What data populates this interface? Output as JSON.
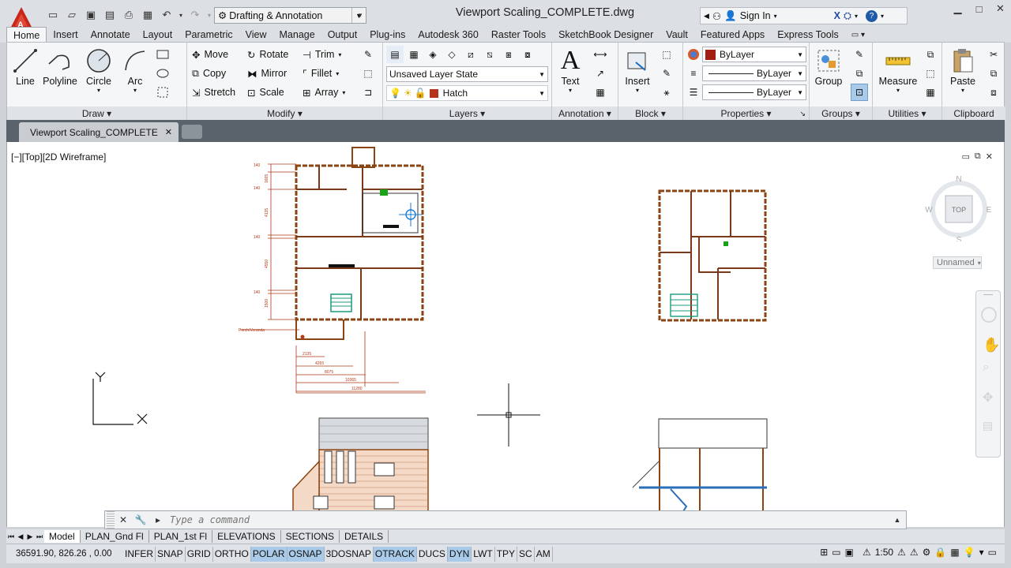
{
  "app": {
    "doc_title": "Viewport Scaling_COMPLETE.dwg",
    "workspace": "Drafting & Annotation",
    "sign_in": "Sign In",
    "accent": "#c8261a"
  },
  "ribbon_tabs": [
    "Home",
    "Insert",
    "Annotate",
    "Layout",
    "Parametric",
    "View",
    "Manage",
    "Output",
    "Plug-ins",
    "Autodesk 360",
    "Raster Tools",
    "SketchBook Designer",
    "Vault",
    "Featured Apps",
    "Express Tools"
  ],
  "draw": {
    "title": "Draw",
    "line": "Line",
    "polyline": "Polyline",
    "circle": "Circle",
    "arc": "Arc"
  },
  "modify": {
    "title": "Modify",
    "move": "Move",
    "rotate": "Rotate",
    "trim": "Trim",
    "copy": "Copy",
    "mirror": "Mirror",
    "fillet": "Fillet",
    "stretch": "Stretch",
    "scale": "Scale",
    "array": "Array"
  },
  "layers": {
    "title": "Layers",
    "state": "Unsaved Layer State",
    "current": "Hatch"
  },
  "annotation": {
    "title": "Annotation",
    "text": "Text"
  },
  "block": {
    "title": "Block",
    "insert": "Insert"
  },
  "properties": {
    "title": "Properties",
    "color": "ByLayer",
    "linetype": "ByLayer",
    "lineweight": "ByLayer"
  },
  "groups": {
    "title": "Groups",
    "group": "Group"
  },
  "utilities": {
    "title": "Utilities",
    "measure": "Measure"
  },
  "clipboard": {
    "title": "Clipboard",
    "paste": "Paste"
  },
  "file_tab": "Viewport Scaling_COMPLETE",
  "viewport": {
    "label": "[−][Top][2D Wireframe]",
    "cube_top": "TOP",
    "n": "N",
    "s": "S",
    "e": "E",
    "w": "W",
    "ucs_name": "Unnamed"
  },
  "drawing": {
    "dims_left": [
      "140",
      "1665",
      "140",
      "4135",
      "140",
      "4550",
      "140",
      "1500"
    ],
    "dims_bottom": [
      "2135",
      "4265",
      "8075",
      "10365",
      "11280"
    ],
    "porch_label": "Porch/Veranda",
    "ucs_x": "X",
    "ucs_y": "Y"
  },
  "command": {
    "placeholder": "Type a command"
  },
  "layout_tabs": [
    "Model",
    "PLAN_Gnd Fl",
    "PLAN_1st Fl",
    "ELEVATIONS",
    "SECTIONS",
    "DETAILS"
  ],
  "status": {
    "coords": "36591.90, 826.26 , 0.00",
    "toggles": [
      {
        "label": "INFER",
        "on": false
      },
      {
        "label": "SNAP",
        "on": false
      },
      {
        "label": "GRID",
        "on": false
      },
      {
        "label": "ORTHO",
        "on": false
      },
      {
        "label": "POLAR",
        "on": true
      },
      {
        "label": "OSNAP",
        "on": true
      },
      {
        "label": "3DOSNAP",
        "on": false
      },
      {
        "label": "OTRACK",
        "on": true
      },
      {
        "label": "DUCS",
        "on": false
      },
      {
        "label": "DYN",
        "on": true
      },
      {
        "label": "LWT",
        "on": false
      },
      {
        "label": "TPY",
        "on": false
      },
      {
        "label": "SC",
        "on": false
      },
      {
        "label": "AM",
        "on": false
      }
    ],
    "anno_scale": "1:50"
  }
}
